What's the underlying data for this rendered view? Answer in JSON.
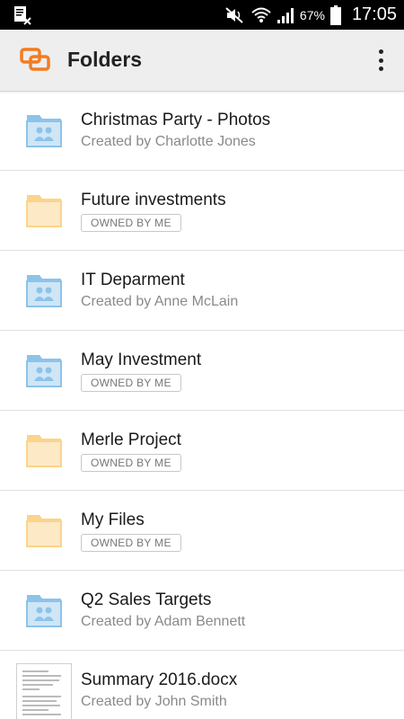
{
  "status_bar": {
    "battery_percent": "67%",
    "time": "17:05",
    "icons": [
      "notification-doc-icon",
      "mute-icon",
      "wifi-icon",
      "signal-icon",
      "battery-icon"
    ]
  },
  "app_bar": {
    "title": "Folders",
    "logo_icon": "app-logo-icon",
    "menu_icon": "overflow-menu-icon",
    "accent_color": "#f47b20"
  },
  "items": [
    {
      "title": "Christmas Party - Photos",
      "subtitle": "Created by Charlotte Jones",
      "icon": "shared-folder-icon"
    },
    {
      "title": "Future investments",
      "badge": "OWNED BY ME",
      "icon": "folder-icon"
    },
    {
      "title": "IT Deparment",
      "subtitle": "Created by Anne McLain",
      "icon": "shared-folder-icon"
    },
    {
      "title": "May Investment",
      "badge": "OWNED BY ME",
      "icon": "shared-folder-icon"
    },
    {
      "title": "Merle Project",
      "badge": "OWNED BY ME",
      "icon": "folder-icon"
    },
    {
      "title": "My Files",
      "badge": "OWNED BY ME",
      "icon": "folder-icon"
    },
    {
      "title": "Q2 Sales Targets",
      "subtitle": "Created by Adam Bennett",
      "icon": "shared-folder-icon"
    },
    {
      "title": "Summary 2016.docx",
      "subtitle": "Created by John Smith",
      "icon": "document-thumbnail-icon"
    }
  ],
  "colors": {
    "shared_folder": "#8cc3ea",
    "personal_folder": "#fbd48a"
  }
}
